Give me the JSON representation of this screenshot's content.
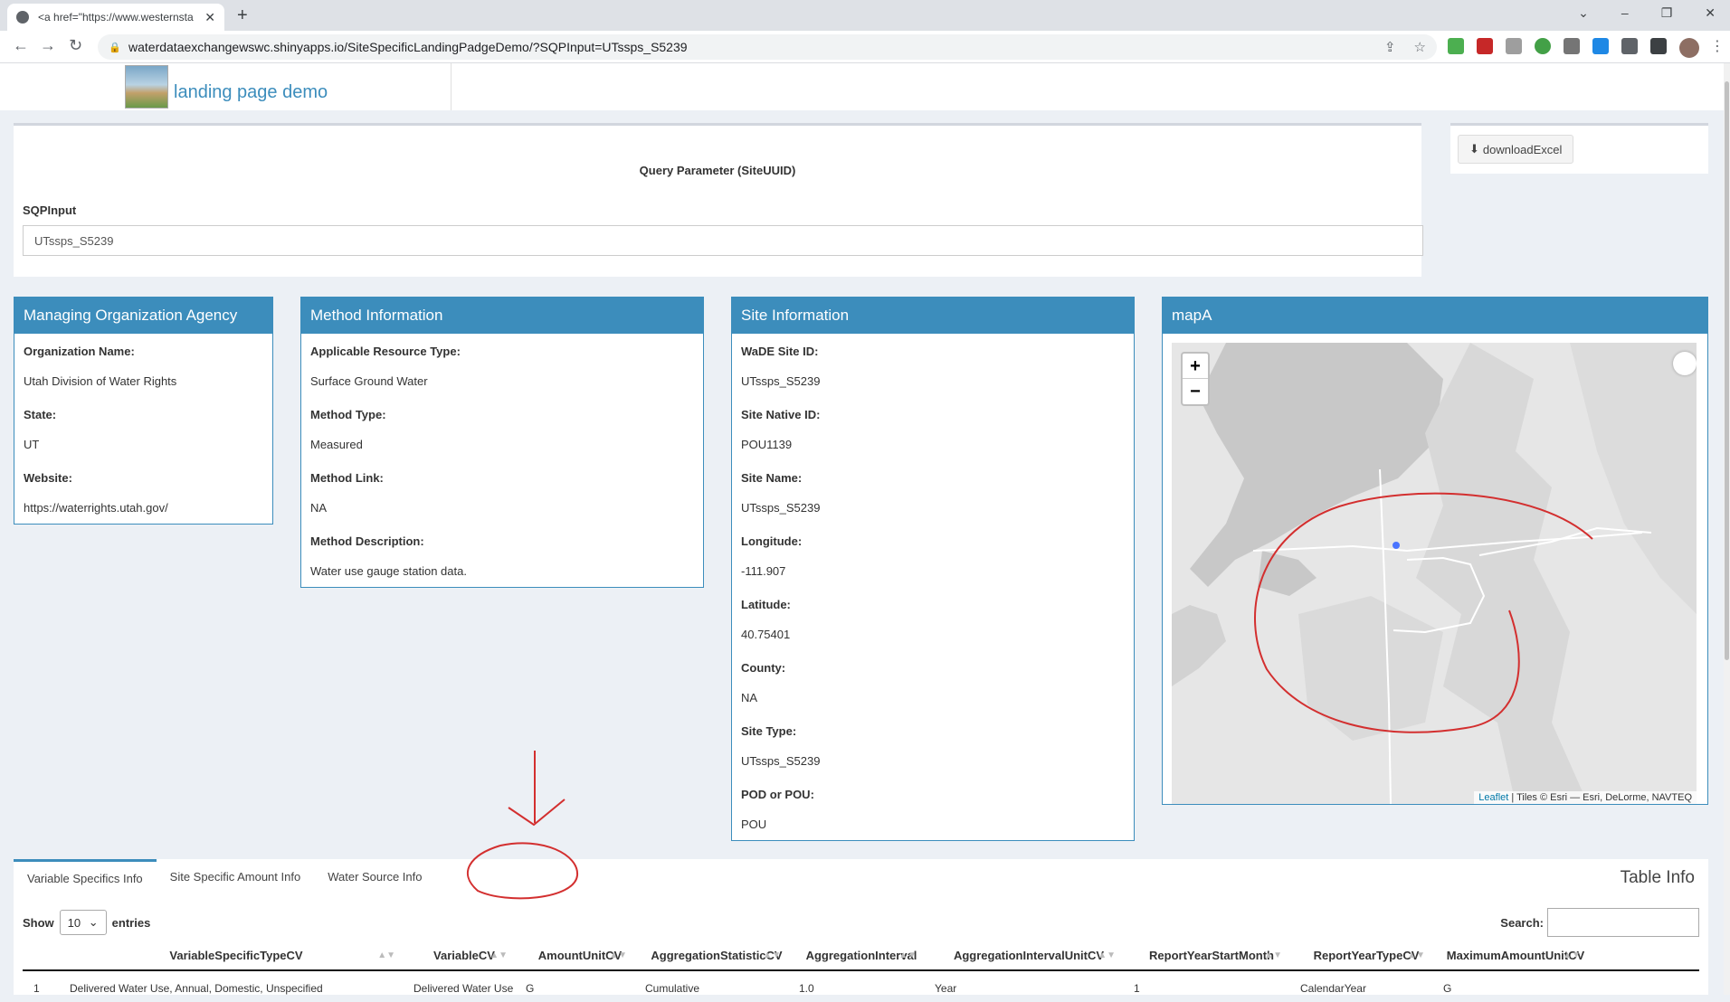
{
  "browser": {
    "tab_title": "<a href=\"https://www.westernsta",
    "url": "waterdataexchangewswc.shinyapps.io/SiteSpecificLandingPadgeDemo/?SQPInput=UTssps_S5239"
  },
  "app": {
    "title": "landing page demo"
  },
  "query": {
    "title": "Query Parameter (SiteUUID)",
    "label": "SQPInput",
    "value": "UTssps_S5239",
    "download_label": "downloadExcel"
  },
  "org": {
    "header": "Managing Organization Agency",
    "fields": [
      {
        "label": "Organization Name:",
        "value": "Utah Division of Water Rights"
      },
      {
        "label": "State:",
        "value": "UT"
      },
      {
        "label": "Website:",
        "value": "https://waterrights.utah.gov/"
      }
    ]
  },
  "method": {
    "header": "Method Information",
    "fields": [
      {
        "label": "Applicable Resource Type:",
        "value": "Surface Ground Water"
      },
      {
        "label": "Method Type:",
        "value": "Measured"
      },
      {
        "label": "Method Link:",
        "value": "NA"
      },
      {
        "label": "Method Description:",
        "value": "Water use gauge station data."
      }
    ]
  },
  "site": {
    "header": "Site Information",
    "fields": [
      {
        "label": "WaDE Site ID:",
        "value": "UTssps_S5239"
      },
      {
        "label": "Site Native ID:",
        "value": "POU1139"
      },
      {
        "label": "Site Name:",
        "value": "UTssps_S5239"
      },
      {
        "label": "Longitude:",
        "value": "-111.907"
      },
      {
        "label": "Latitude:",
        "value": "40.75401"
      },
      {
        "label": "County:",
        "value": "NA"
      },
      {
        "label": "Site Type:",
        "value": "UTssps_S5239"
      },
      {
        "label": "POD or POU:",
        "value": "POU"
      }
    ]
  },
  "map": {
    "header": "mapA",
    "zoom_in": "+",
    "zoom_out": "−",
    "attribution_link": "Leaflet",
    "attribution_text": " | Tiles © Esri — Esri, DeLorme, NAVTEQ"
  },
  "tabs": {
    "items": [
      "Variable Specifics Info",
      "Site Specific Amount Info",
      "Water Source Info"
    ],
    "active": 0,
    "table_info": "Table Info"
  },
  "table": {
    "show_label": "Show",
    "entries_value": "10",
    "entries_label": "entries",
    "search_label": "Search:",
    "columns": [
      "VariableSpecificTypeCV",
      "VariableCV",
      "AmountUnitCV",
      "AggregationStatisticCV",
      "AggregationInterval",
      "AggregationIntervalUnitCV",
      "ReportYearStartMonth",
      "ReportYearTypeCV",
      "MaximumAmountUnitCV"
    ],
    "rows": [
      [
        "1",
        "Delivered Water Use, Annual, Domestic, Unspecified",
        "Delivered Water Use",
        "G",
        "Cumulative",
        "1.0",
        "Year",
        "1",
        "CalendarYear",
        "G"
      ]
    ]
  },
  "colors": {
    "primary": "#3c8dbc",
    "annotation": "#d32f2f"
  }
}
